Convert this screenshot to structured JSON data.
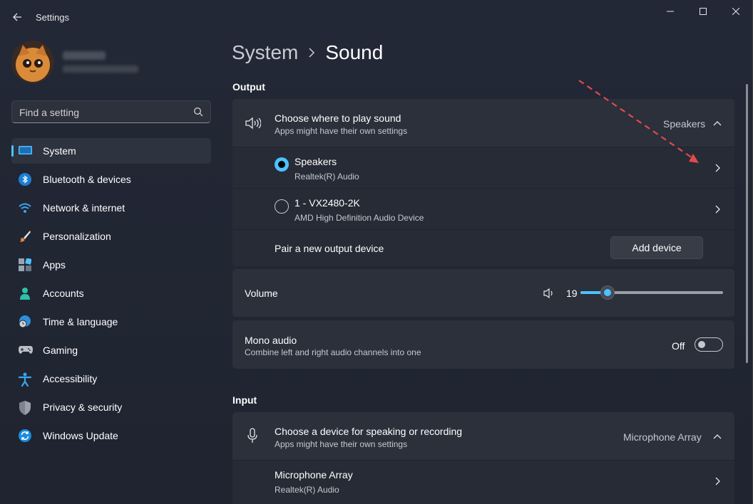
{
  "app": {
    "title": "Settings"
  },
  "search": {
    "placeholder": "Find a setting"
  },
  "nav": [
    {
      "label": "System",
      "icon": "system-icon",
      "active": true
    },
    {
      "label": "Bluetooth & devices",
      "icon": "bluetooth-icon"
    },
    {
      "label": "Network & internet",
      "icon": "wifi-icon"
    },
    {
      "label": "Personalization",
      "icon": "brush-icon"
    },
    {
      "label": "Apps",
      "icon": "apps-icon"
    },
    {
      "label": "Accounts",
      "icon": "accounts-icon"
    },
    {
      "label": "Time & language",
      "icon": "globe-clock-icon"
    },
    {
      "label": "Gaming",
      "icon": "gamepad-icon"
    },
    {
      "label": "Accessibility",
      "icon": "accessibility-icon"
    },
    {
      "label": "Privacy & security",
      "icon": "shield-icon"
    },
    {
      "label": "Windows Update",
      "icon": "update-icon"
    }
  ],
  "breadcrumb": {
    "parent": "System",
    "current": "Sound"
  },
  "output": {
    "heading": "Output",
    "choose": {
      "title": "Choose where to play sound",
      "subtitle": "Apps might have their own settings",
      "selected": "Speakers"
    },
    "devices": [
      {
        "name": "Speakers",
        "driver": "Realtek(R) Audio",
        "selected": true
      },
      {
        "name": "1 - VX2480-2K",
        "driver": "AMD High Definition Audio Device",
        "selected": false
      }
    ],
    "pair": {
      "label": "Pair a new output device",
      "button": "Add device"
    },
    "volume": {
      "label": "Volume",
      "value": "19",
      "level": 0.19
    },
    "mono": {
      "title": "Mono audio",
      "subtitle": "Combine left and right audio channels into one",
      "state": "Off"
    }
  },
  "input": {
    "heading": "Input",
    "choose": {
      "title": "Choose a device for speaking or recording",
      "subtitle": "Apps might have their own settings",
      "selected": "Microphone Array"
    },
    "devices": [
      {
        "name": "Microphone Array",
        "driver": "Realtek(R) Audio"
      }
    ]
  },
  "colors": {
    "accent": "#4cc2ff",
    "annotation": "#e04b4b"
  }
}
